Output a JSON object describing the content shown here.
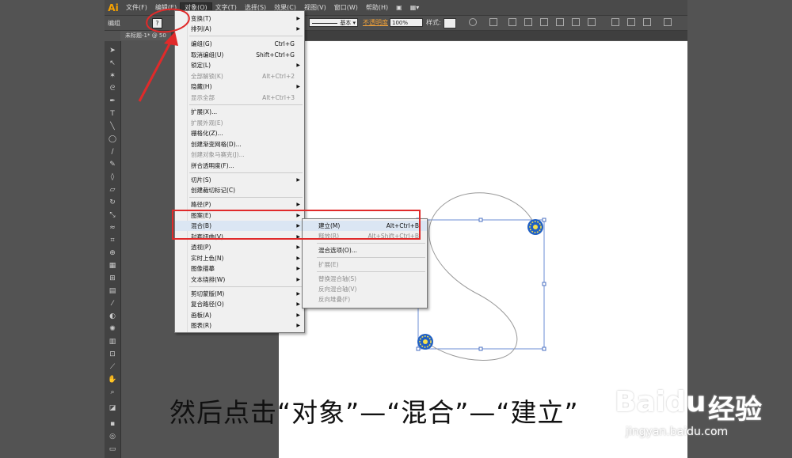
{
  "app": {
    "logo": "Ai"
  },
  "menubar": {
    "items": [
      "文件(F)",
      "编辑(E)",
      "对象(O)",
      "文字(T)",
      "选择(S)",
      "效果(C)",
      "视图(V)",
      "窗口(W)",
      "帮助(H)"
    ]
  },
  "control_bar": {
    "selection_label": "编组",
    "question_icon": "?",
    "stroke_profile": "基本",
    "opacity_label": "不透明度",
    "opacity_value": "100%",
    "style_label": "样式:"
  },
  "doc_tab": {
    "title": "未标题-1* @ 50"
  },
  "object_menu": {
    "items": [
      {
        "label": "变换(T)",
        "shortcut": "",
        "submenu": true,
        "disabled": false
      },
      {
        "label": "排列(A)",
        "shortcut": "",
        "submenu": true,
        "disabled": false
      },
      {
        "label": "编组(G)",
        "shortcut": "Ctrl+G",
        "submenu": false,
        "disabled": false
      },
      {
        "label": "取消编组(U)",
        "shortcut": "Shift+Ctrl+G",
        "submenu": false,
        "disabled": false
      },
      {
        "label": "锁定(L)",
        "shortcut": "",
        "submenu": true,
        "disabled": false
      },
      {
        "label": "全部解锁(K)",
        "shortcut": "Alt+Ctrl+2",
        "submenu": false,
        "disabled": true
      },
      {
        "label": "隐藏(H)",
        "shortcut": "",
        "submenu": true,
        "disabled": false
      },
      {
        "label": "显示全部",
        "shortcut": "Alt+Ctrl+3",
        "submenu": false,
        "disabled": true
      },
      {
        "label": "扩展(X)...",
        "shortcut": "",
        "submenu": false,
        "disabled": false
      },
      {
        "label": "扩展外观(E)",
        "shortcut": "",
        "submenu": false,
        "disabled": true
      },
      {
        "label": "栅格化(Z)...",
        "shortcut": "",
        "submenu": false,
        "disabled": false
      },
      {
        "label": "创建渐变网格(D)...",
        "shortcut": "",
        "submenu": false,
        "disabled": false
      },
      {
        "label": "创建对象马赛克(J)...",
        "shortcut": "",
        "submenu": false,
        "disabled": true
      },
      {
        "label": "拼合透明度(F)...",
        "shortcut": "",
        "submenu": false,
        "disabled": false
      },
      {
        "label": "切片(S)",
        "shortcut": "",
        "submenu": true,
        "disabled": false
      },
      {
        "label": "创建裁切标记(C)",
        "shortcut": "",
        "submenu": false,
        "disabled": false
      },
      {
        "label": "路径(P)",
        "shortcut": "",
        "submenu": true,
        "disabled": false
      },
      {
        "label": "图案(E)",
        "shortcut": "",
        "submenu": true,
        "disabled": false
      },
      {
        "label": "混合(B)",
        "shortcut": "",
        "submenu": true,
        "disabled": false
      },
      {
        "label": "封套扭曲(V)",
        "shortcut": "",
        "submenu": true,
        "disabled": false
      },
      {
        "label": "透视(P)",
        "shortcut": "",
        "submenu": true,
        "disabled": false
      },
      {
        "label": "实时上色(N)",
        "shortcut": "",
        "submenu": true,
        "disabled": false
      },
      {
        "label": "图像描摹",
        "shortcut": "",
        "submenu": true,
        "disabled": false
      },
      {
        "label": "文本绕排(W)",
        "shortcut": "",
        "submenu": true,
        "disabled": false
      },
      {
        "label": "剪切蒙版(M)",
        "shortcut": "",
        "submenu": true,
        "disabled": false
      },
      {
        "label": "复合路径(O)",
        "shortcut": "",
        "submenu": true,
        "disabled": false
      },
      {
        "label": "画板(A)",
        "shortcut": "",
        "submenu": true,
        "disabled": false
      },
      {
        "label": "图表(R)",
        "shortcut": "",
        "submenu": true,
        "disabled": false
      }
    ]
  },
  "blend_submenu": {
    "items": [
      {
        "label": "建立(M)",
        "shortcut": "Alt+Ctrl+B",
        "disabled": false
      },
      {
        "label": "释放(R)",
        "shortcut": "Alt+Shift+Ctrl+B",
        "disabled": true
      },
      {
        "label": "混合选项(O)...",
        "shortcut": "",
        "disabled": false
      },
      {
        "label": "扩展(E)",
        "shortcut": "",
        "disabled": true
      },
      {
        "label": "替换混合轴(S)",
        "shortcut": "",
        "disabled": true
      },
      {
        "label": "反向混合轴(V)",
        "shortcut": "",
        "disabled": true
      },
      {
        "label": "反向堆叠(F)",
        "shortcut": "",
        "disabled": true
      }
    ]
  },
  "caption": "然后点击“对象”—“混合”—“建立”",
  "watermark": {
    "brand": "Baidu",
    "product": "经验",
    "url": "jingyan.baidu.com"
  },
  "colors": {
    "annotation_red": "#e02a2a",
    "blend_blue": "#1f5fc4",
    "blend_yellow": "#f4e04d",
    "ai_orange": "#f7a200"
  }
}
